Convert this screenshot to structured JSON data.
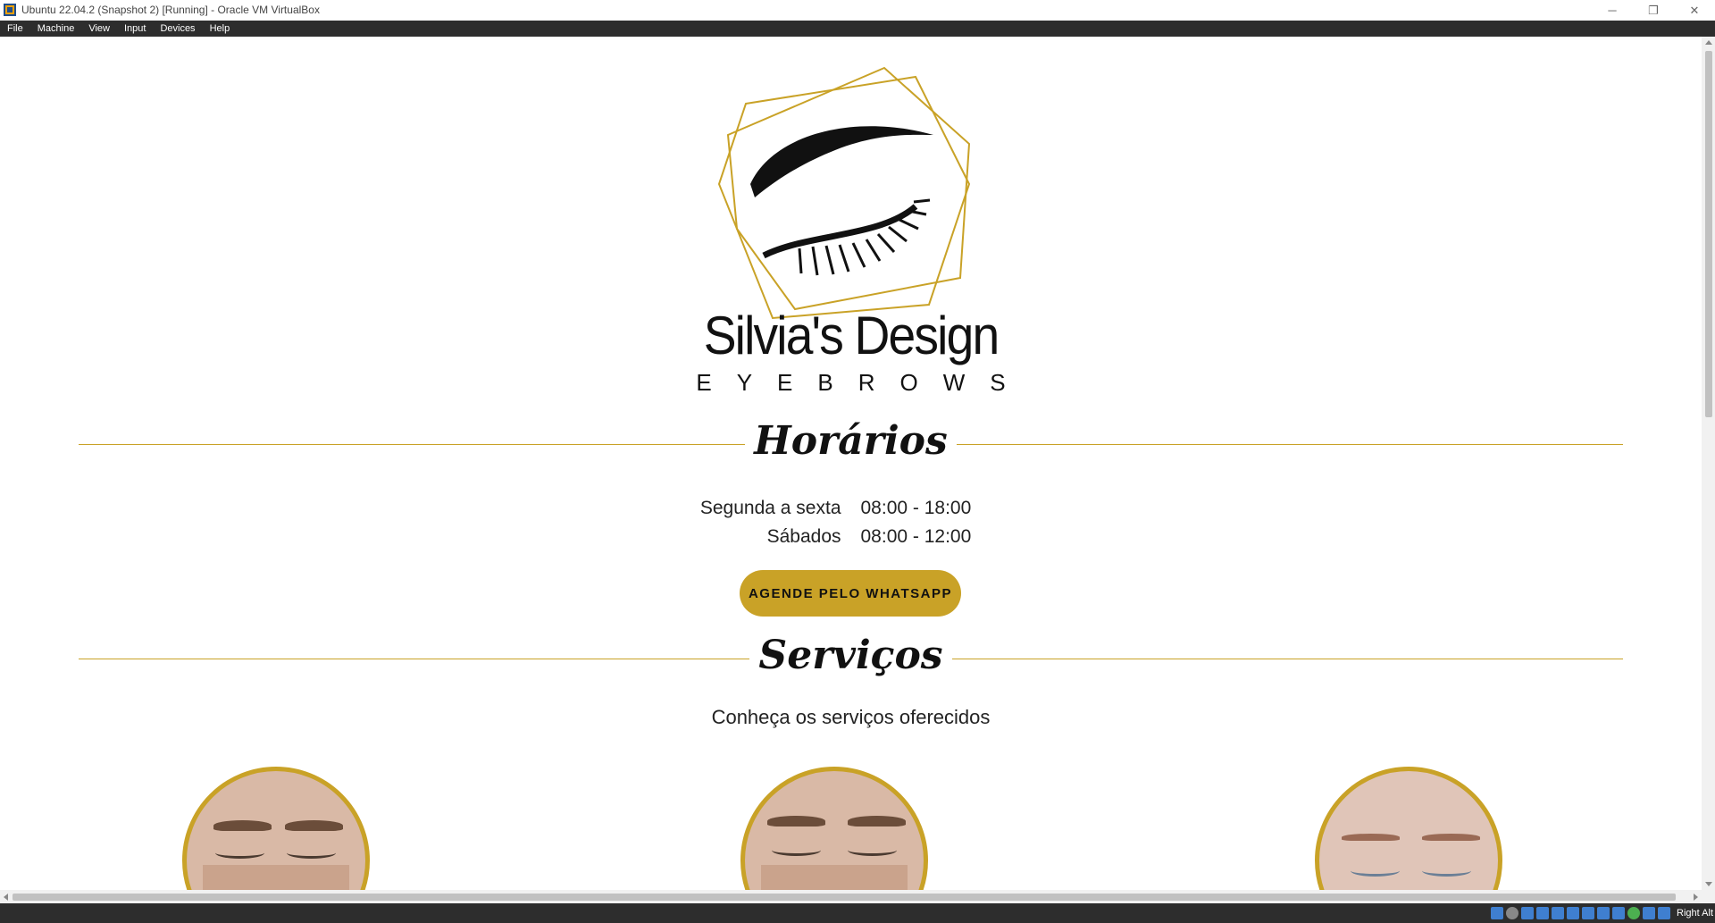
{
  "window": {
    "title": "Ubuntu 22.04.2 (Snapshot 2) [Running] - Oracle VM VirtualBox",
    "controls": {
      "minimize": "─",
      "restore": "❐",
      "close": "✕"
    }
  },
  "menubar": {
    "items": [
      "File",
      "Machine",
      "View",
      "Input",
      "Devices",
      "Help"
    ]
  },
  "page": {
    "brand_name": "Silvia's Design",
    "brand_sub": "EYEBROWS",
    "hours_title": "Horários",
    "hours": [
      {
        "day": "Segunda a sexta",
        "time": "08:00 - 18:00"
      },
      {
        "day": "Sábados",
        "time": "08:00 - 12:00"
      }
    ],
    "cta_label": "AGENDE PELO WHATSAPP",
    "services_title": "Serviços",
    "services_sub": "Conheça os serviços oferecidos"
  },
  "statusbar": {
    "host_key": "Right Alt"
  },
  "colors": {
    "accent": "#c9a227",
    "menubar": "#2d2d2d",
    "text": "#111111"
  }
}
